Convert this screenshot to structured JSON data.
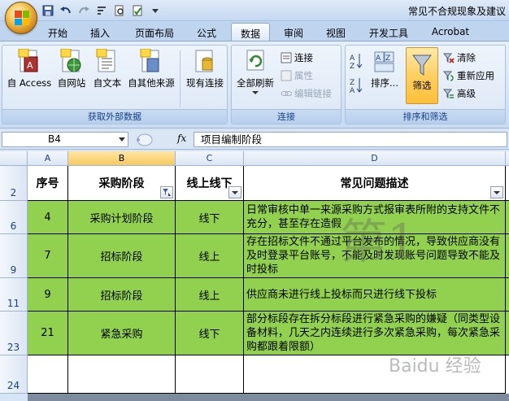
{
  "window": {
    "title": "常见不合规现象及建议"
  },
  "tabs": [
    {
      "label": "开始"
    },
    {
      "label": "插入"
    },
    {
      "label": "页面布局"
    },
    {
      "label": "公式"
    },
    {
      "label": "数据"
    },
    {
      "label": "审阅"
    },
    {
      "label": "视图"
    },
    {
      "label": "开发工具"
    },
    {
      "label": "Acrobat"
    }
  ],
  "ribbon": {
    "external": {
      "label": "获取外部数据",
      "access": "自 Access",
      "web": "自网站",
      "text": "自文本",
      "other": "自其他来源",
      "existing": "现有连接"
    },
    "connections": {
      "label": "连接",
      "refresh_all": "全部刷新",
      "connections": "连接",
      "properties": "属性",
      "edit_links": "编辑链接"
    },
    "sort_filter": {
      "label": "排序和筛选",
      "sort": "排序...",
      "filter": "筛选",
      "clear": "清除",
      "reapply": "重新应用",
      "advanced": "高级"
    }
  },
  "formula_bar": {
    "name_box": "B4",
    "fx": "fx",
    "formula": "项目编制阶段"
  },
  "columns": [
    "A",
    "B",
    "C",
    "D"
  ],
  "headers": {
    "seq": "序号",
    "stage": "采购阶段",
    "online": "线上线下",
    "issue": "常见问题描述"
  },
  "rows": [
    {
      "row": "6",
      "seq": "4",
      "stage": "采购计划阶段",
      "online": "线下",
      "issue": "日常审核中单一来源采购方式报审表所附的支持文件不充分，甚至存在造假"
    },
    {
      "row": "9",
      "seq": "7",
      "stage": "招标阶段",
      "online": "线上",
      "issue": "存在招标文件不通过平台发布的情况，导致供应商没有及时登录平台账号，不能及时发现账号问题导致不能及时投标"
    },
    {
      "row": "11",
      "seq": "9",
      "stage": "招标阶段",
      "online": "线上",
      "issue": "供应商未进行线上投标而只进行线下投标"
    },
    {
      "row": "23",
      "seq": "21",
      "stage": "紧急采购",
      "online": "线下",
      "issue": "部分标段存在拆分标段进行紧急采购的嫌疑（同类型设备材料，几天之内连续进行多次紧急采购，每次紧急采购都跟着限额）"
    }
  ],
  "row_labels": {
    "header": "2",
    "empty": "24"
  },
  "watermark": {
    "big": "第1",
    "small": "Baidu 经验"
  }
}
